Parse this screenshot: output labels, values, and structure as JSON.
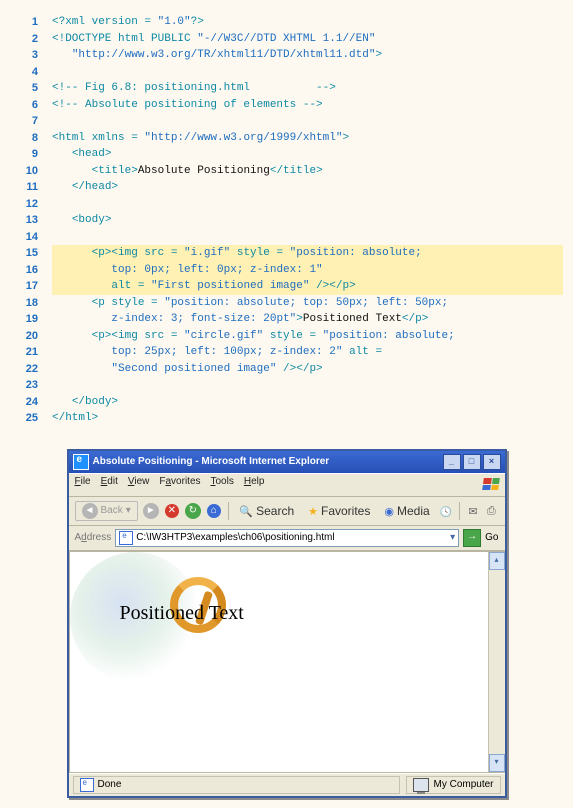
{
  "code": {
    "lines": [
      {
        "n": 1,
        "hl": false,
        "segs": [
          {
            "c": "tok-kw",
            "t": "<?xml version = "
          },
          {
            "c": "tok-str",
            "t": "\"1.0\""
          },
          {
            "c": "tok-kw",
            "t": "?>"
          }
        ]
      },
      {
        "n": 2,
        "hl": false,
        "segs": [
          {
            "c": "tok-kw",
            "t": "<!DOCTYPE html PUBLIC "
          },
          {
            "c": "tok-str",
            "t": "\"-//W3C//DTD XHTML 1.1//EN\""
          }
        ]
      },
      {
        "n": 3,
        "hl": false,
        "segs": [
          {
            "c": "tok-plain",
            "t": "   "
          },
          {
            "c": "tok-str",
            "t": "\"http://www.w3.org/TR/xhtml11/DTD/xhtml11.dtd\""
          },
          {
            "c": "tok-kw",
            "t": ">"
          }
        ]
      },
      {
        "n": 4,
        "hl": false,
        "segs": []
      },
      {
        "n": 5,
        "hl": false,
        "segs": [
          {
            "c": "tok-cmt",
            "t": "<!-- Fig 6.8: positioning.html          -->"
          }
        ]
      },
      {
        "n": 6,
        "hl": false,
        "segs": [
          {
            "c": "tok-cmt",
            "t": "<!-- Absolute positioning of elements -->"
          }
        ]
      },
      {
        "n": 7,
        "hl": false,
        "segs": []
      },
      {
        "n": 8,
        "hl": false,
        "segs": [
          {
            "c": "tok-kw",
            "t": "<html xmlns = "
          },
          {
            "c": "tok-str",
            "t": "\"http://www.w3.org/1999/xhtml\""
          },
          {
            "c": "tok-kw",
            "t": ">"
          }
        ]
      },
      {
        "n": 9,
        "hl": false,
        "segs": [
          {
            "c": "tok-plain",
            "t": "   "
          },
          {
            "c": "tok-kw",
            "t": "<head>"
          }
        ]
      },
      {
        "n": 10,
        "hl": false,
        "segs": [
          {
            "c": "tok-plain",
            "t": "      "
          },
          {
            "c": "tok-kw",
            "t": "<title>"
          },
          {
            "c": "tok-plain",
            "t": "Absolute Positioning"
          },
          {
            "c": "tok-kw",
            "t": "</title>"
          }
        ]
      },
      {
        "n": 11,
        "hl": false,
        "segs": [
          {
            "c": "tok-plain",
            "t": "   "
          },
          {
            "c": "tok-kw",
            "t": "</head>"
          }
        ]
      },
      {
        "n": 12,
        "hl": false,
        "segs": []
      },
      {
        "n": 13,
        "hl": false,
        "segs": [
          {
            "c": "tok-plain",
            "t": "   "
          },
          {
            "c": "tok-kw",
            "t": "<body>"
          }
        ]
      },
      {
        "n": 14,
        "hl": false,
        "segs": []
      },
      {
        "n": 15,
        "hl": true,
        "segs": [
          {
            "c": "tok-plain",
            "t": "      "
          },
          {
            "c": "tok-kw",
            "t": "<p><img src = "
          },
          {
            "c": "tok-str",
            "t": "\"i.gif\""
          },
          {
            "c": "tok-kw",
            "t": " style = "
          },
          {
            "c": "tok-str",
            "t": "\"position: absolute;"
          }
        ]
      },
      {
        "n": 16,
        "hl": true,
        "segs": [
          {
            "c": "tok-plain",
            "t": "         "
          },
          {
            "c": "tok-str",
            "t": "top: 0px; left: 0px; z-index: 1\""
          }
        ]
      },
      {
        "n": 17,
        "hl": true,
        "segs": [
          {
            "c": "tok-plain",
            "t": "         "
          },
          {
            "c": "tok-kw",
            "t": "alt = "
          },
          {
            "c": "tok-str",
            "t": "\"First positioned image\""
          },
          {
            "c": "tok-kw",
            "t": " /></p>"
          }
        ]
      },
      {
        "n": 18,
        "hl": false,
        "segs": [
          {
            "c": "tok-plain",
            "t": "      "
          },
          {
            "c": "tok-kw",
            "t": "<p style = "
          },
          {
            "c": "tok-str",
            "t": "\"position: absolute; top: 50px; left: 50px;"
          }
        ]
      },
      {
        "n": 19,
        "hl": false,
        "segs": [
          {
            "c": "tok-plain",
            "t": "         "
          },
          {
            "c": "tok-str",
            "t": "z-index: 3; font-size: 20pt\""
          },
          {
            "c": "tok-kw",
            "t": ">"
          },
          {
            "c": "tok-plain",
            "t": "Positioned Text"
          },
          {
            "c": "tok-kw",
            "t": "</p>"
          }
        ]
      },
      {
        "n": 20,
        "hl": false,
        "segs": [
          {
            "c": "tok-plain",
            "t": "      "
          },
          {
            "c": "tok-kw",
            "t": "<p><img src = "
          },
          {
            "c": "tok-str",
            "t": "\"circle.gif\""
          },
          {
            "c": "tok-kw",
            "t": " style = "
          },
          {
            "c": "tok-str",
            "t": "\"position: absolute;"
          }
        ]
      },
      {
        "n": 21,
        "hl": false,
        "segs": [
          {
            "c": "tok-plain",
            "t": "         "
          },
          {
            "c": "tok-str",
            "t": "top: 25px; left: 100px; z-index: 2\""
          },
          {
            "c": "tok-kw",
            "t": " alt = "
          }
        ]
      },
      {
        "n": 22,
        "hl": false,
        "segs": [
          {
            "c": "tok-plain",
            "t": "         "
          },
          {
            "c": "tok-str",
            "t": "\"Second positioned image\""
          },
          {
            "c": "tok-kw",
            "t": " /></p>"
          }
        ]
      },
      {
        "n": 23,
        "hl": false,
        "segs": []
      },
      {
        "n": 24,
        "hl": false,
        "segs": [
          {
            "c": "tok-plain",
            "t": "   "
          },
          {
            "c": "tok-kw",
            "t": "</body>"
          }
        ]
      },
      {
        "n": 25,
        "hl": false,
        "segs": [
          {
            "c": "tok-kw",
            "t": "</html>"
          }
        ]
      }
    ]
  },
  "browser": {
    "title": "Absolute Positioning - Microsoft Internet Explorer",
    "win_buttons": {
      "min": "_",
      "max": "□",
      "close": "×"
    },
    "menu": [
      "File",
      "Edit",
      "View",
      "Favorites",
      "Tools",
      "Help"
    ],
    "toolbar": {
      "back_label": "Back",
      "search_label": "Search",
      "favorites_label": "Favorites",
      "media_label": "Media"
    },
    "address_label": "Address",
    "address_value": "C:\\IW3HTP3\\examples\\ch06\\positioning.html",
    "go_label": "Go",
    "page": {
      "positioned_text": "Positioned Text"
    },
    "status": {
      "done": "Done",
      "zone": "My Computer"
    }
  }
}
